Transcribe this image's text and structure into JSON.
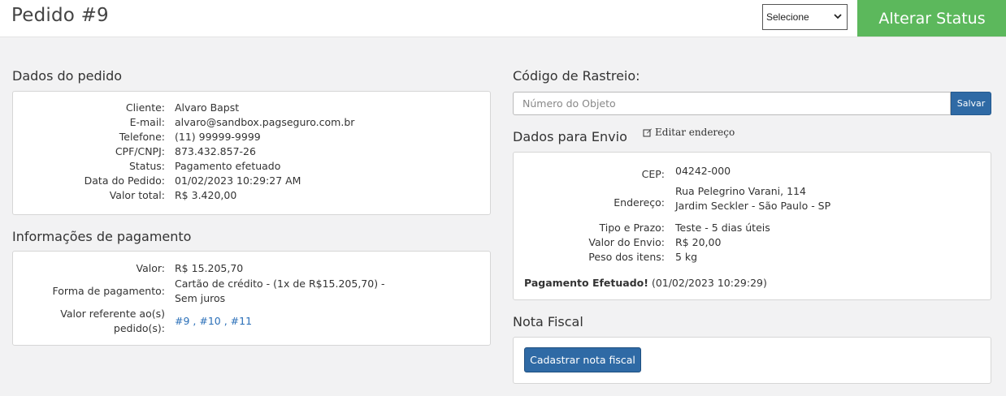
{
  "header": {
    "title": "Pedido #9",
    "status_select_value": "Selecione",
    "alter_status_label": "Alterar Status"
  },
  "order": {
    "section_title": "Dados do pedido",
    "rows": [
      {
        "label": "Cliente:",
        "value": "Alvaro Bapst"
      },
      {
        "label": "E-mail:",
        "value": "alvaro@sandbox.pagseguro.com.br"
      },
      {
        "label": "Telefone:",
        "value": "(11) 99999-9999"
      },
      {
        "label": "CPF/CNPJ:",
        "value": "873.432.857-26"
      },
      {
        "label": "Status:",
        "value": "Pagamento efetuado"
      },
      {
        "label": "Data do Pedido:",
        "value": "01/02/2023 10:29:27 AM"
      },
      {
        "label": "Valor total:",
        "value": "R$ 3.420,00"
      }
    ]
  },
  "payment": {
    "section_title": "Informações de pagamento",
    "valor_label": "Valor:",
    "valor": "R$ 15.205,70",
    "forma_label": "Forma de pagamento:",
    "forma_line1": "Cartão de crédito - (1x de R$15.205,70) -",
    "forma_line2": "Sem juros",
    "ref_label_line1": "Valor referente ao(s)",
    "ref_label_line2": "pedido(s):",
    "ref_orders": [
      "#9",
      "#10",
      "#11"
    ]
  },
  "tracking": {
    "section_title": "Código de Rastreio:",
    "input_placeholder": "Número do Objeto",
    "save_label": "Salvar"
  },
  "shipping": {
    "section_title": "Dados para Envio",
    "edit_label": "Editar endereço",
    "cep_label": "CEP:",
    "cep": "04242-000",
    "endereco_label": "Endereço:",
    "endereco_line1": "Rua Pelegrino Varani, 114",
    "endereco_line2": "Jardim Seckler - São Paulo - SP",
    "tipo_label": "Tipo e Prazo:",
    "tipo": "Teste - 5 dias úteis",
    "valor_envio_label": "Valor do Envio:",
    "valor_envio": "R$ 20,00",
    "peso_label": "Peso dos itens:",
    "peso": "5 kg",
    "payment_status_bold": "Pagamento Efetuado!",
    "payment_status_date": " (01/02/2023 10:29:29)"
  },
  "invoice": {
    "section_title": "Nota Fiscal",
    "button_label": "Cadastrar nota fiscal"
  },
  "icons": {
    "select_chevron": "chevron-down-icon",
    "edit": "pencil-square-icon"
  },
  "colors": {
    "alter_button": "#5cb85c",
    "primary_button": "#2f6aa5",
    "link": "#2a6fb8"
  }
}
